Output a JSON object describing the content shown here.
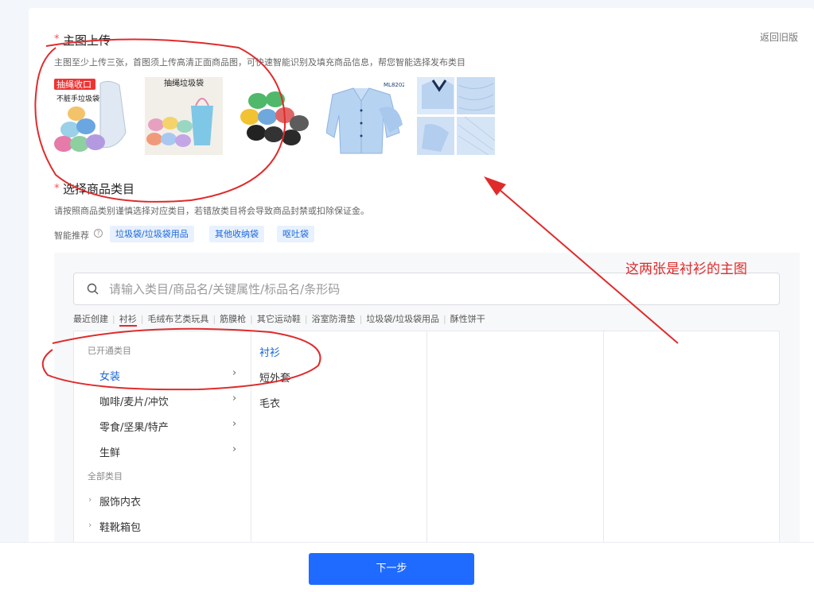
{
  "upload": {
    "required_mark": "*",
    "title": "主图上传",
    "hint": "主图至少上传三张，首图须上传高清正面商品图，可快速智能识别及填充商品信息，帮您智能选择发布类目",
    "back_link": "返回旧版",
    "images": [
      {
        "caption_top": "抽绳收口",
        "caption_bottom": "不脏手垃圾袋"
      },
      {
        "caption_top": "抽绳垃圾袋"
      },
      {
        "caption_top": ""
      },
      {
        "caption_top": "ML8202"
      },
      {
        "caption_top": ""
      }
    ]
  },
  "category": {
    "required_mark": "*",
    "title": "选择商品类目",
    "hint": "请按照商品类别谨慎选择对应类目，若错放类目将会导致商品封禁或扣除保证金。",
    "smart_label": "智能推荐",
    "smart_tags": [
      "垃圾袋/垃圾袋用品",
      "其他收纳袋",
      "呕吐袋"
    ],
    "search_placeholder": "请输入类目/商品名/关键属性/标品名/条形码",
    "recent_label": "最近创建",
    "recent_items": [
      "衬衫",
      "毛绒布艺类玩具",
      "筋膜枪",
      "其它运动鞋",
      "浴室防滑垫",
      "垃圾袋/垃圾袋用品",
      "酥性饼干"
    ],
    "opened_header": "已开通类目",
    "opened": [
      "女装",
      "咖啡/麦片/冲饮",
      "零食/坚果/特产",
      "生鲜"
    ],
    "all_header": "全部类目",
    "all": [
      "服饰内衣",
      "鞋靴箱包"
    ],
    "sub_items": [
      "衬衫",
      "短外套",
      "毛衣"
    ]
  },
  "footer": {
    "next_label": "下一步"
  },
  "annotation": {
    "text": "这两张是衬衫的主图",
    "color": "#e02b2b"
  },
  "colors": {
    "accent": "#1f6bff",
    "link": "#1a66d9",
    "required": "#ff4d4f"
  }
}
